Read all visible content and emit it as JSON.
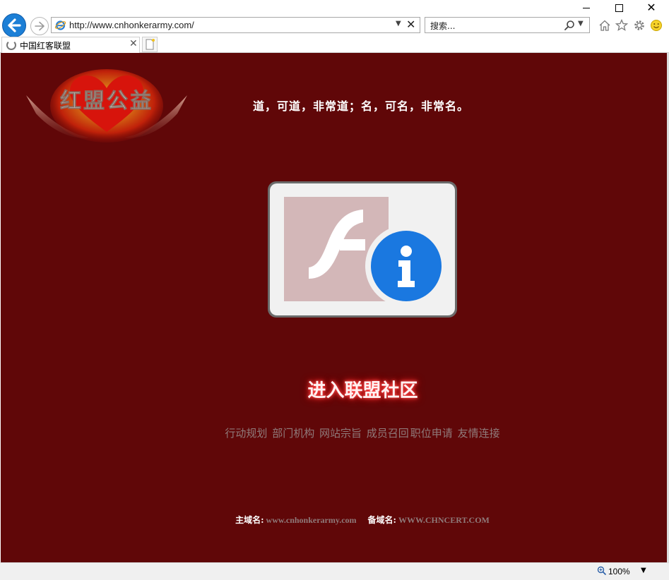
{
  "browser": {
    "address_url": "http://www.cnhonkerarmy.com/",
    "search_placeholder": "搜索...",
    "tab_title": "中国红客联盟",
    "zoom_label": "100%"
  },
  "page": {
    "logo_text": "红盟公益",
    "motto": "道，可道，非常道；名，可名，非常名。",
    "enter_label": "进入联盟社区",
    "nav_links": [
      "行动规划",
      "部门机构",
      "网站宗旨",
      "成员召回",
      "职位申请",
      "友情连接"
    ],
    "primary_domain_label": "主域名:",
    "primary_domain": "www.cnhonkerarmy.com",
    "backup_domain_label": "备域名:",
    "backup_domain": "WWW.CHNCERT.COM"
  },
  "colors": {
    "page_background": "#600708",
    "link_text": "#8f7a7a",
    "flash_info_blue": "#1a78e0",
    "back_button_blue": "#1c7fd6"
  },
  "icons": {
    "flash_placeholder": "flash-plugin-info-icon",
    "back": "back-arrow-icon",
    "forward": "forward-arrow-icon"
  }
}
